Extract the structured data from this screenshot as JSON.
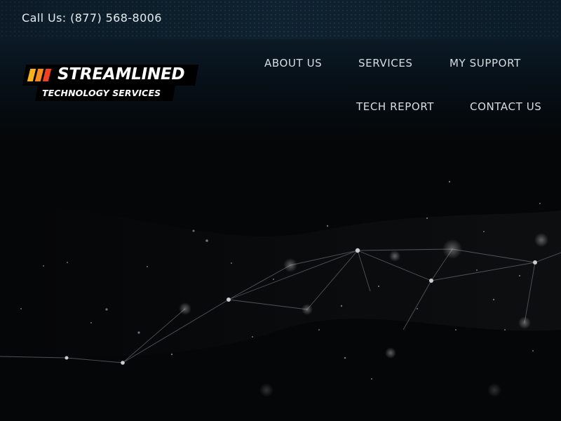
{
  "topbar": {
    "phone_text": "Call Us: (877) 568-8006"
  },
  "logo": {
    "name": "STREAMLINED",
    "tagline": "TECHNOLOGY SERVICES",
    "stripe_colors": [
      "#f7b21c",
      "#f58a1f",
      "#ee4223"
    ]
  },
  "nav": {
    "items": [
      {
        "label": "ABOUT US"
      },
      {
        "label": "SERVICES"
      },
      {
        "label": "MY SUPPORT"
      },
      {
        "label": "TECH REPORT"
      },
      {
        "label": "CONTACT US"
      }
    ]
  },
  "colors": {
    "topbar_bg": "#0f2230",
    "page_bg": "#050607",
    "nav_text": "#d6dde3"
  },
  "hero": {
    "background": "network-plexus-graphic"
  }
}
